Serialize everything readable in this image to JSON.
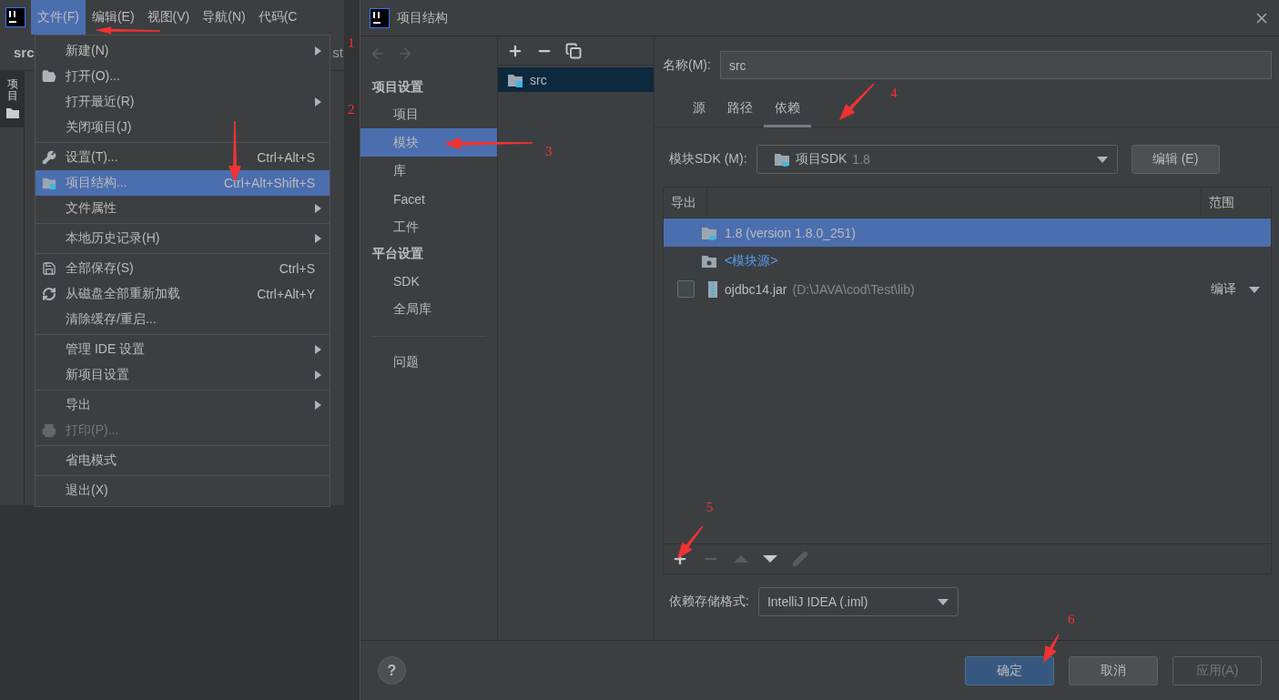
{
  "ide": {
    "menubar": [
      {
        "label": "文件(F)",
        "selected": true
      },
      {
        "label": "编辑(E)",
        "selected": false
      },
      {
        "label": "视图(V)",
        "selected": false
      },
      {
        "label": "导航(N)",
        "selected": false
      },
      {
        "label": "代码(C",
        "selected": false
      }
    ],
    "editor_tabs": [
      {
        "label": "src"
      },
      {
        "label": "st"
      }
    ],
    "tool_window": {
      "label": "项目"
    },
    "file_menu": {
      "groups": [
        [
          {
            "label": "新建(N)",
            "submenu": true,
            "selected": false,
            "disabled": false
          },
          {
            "label": "打开(O)...",
            "kind": "folder-open",
            "selected": false,
            "disabled": false
          },
          {
            "label": "打开最近(R)",
            "submenu": true,
            "selected": false,
            "disabled": false
          },
          {
            "label": "关闭项目(J)",
            "selected": false,
            "disabled": false
          }
        ],
        [
          {
            "label": "设置(T)...",
            "kind": "wrench",
            "shortcut": "Ctrl+Alt+S",
            "selected": false,
            "disabled": false
          },
          {
            "label": "项目结构...",
            "kind": "project-structure",
            "shortcut": "Ctrl+Alt+Shift+S",
            "selected": true,
            "disabled": false
          },
          {
            "label": "文件属性",
            "submenu": true,
            "selected": false,
            "disabled": false
          }
        ],
        [
          {
            "label": "本地历史记录(H)",
            "submenu": true,
            "selected": false,
            "disabled": false
          }
        ],
        [
          {
            "label": "全部保存(S)",
            "kind": "save",
            "shortcut": "Ctrl+S",
            "selected": false,
            "disabled": false
          },
          {
            "label": "从磁盘全部重新加载",
            "kind": "refresh",
            "shortcut": "Ctrl+Alt+Y",
            "selected": false,
            "disabled": false
          },
          {
            "label": "清除缓存/重启...",
            "selected": false,
            "disabled": false
          }
        ],
        [
          {
            "label": "管理 IDE 设置",
            "submenu": true,
            "selected": false,
            "disabled": false
          },
          {
            "label": "新项目设置",
            "submenu": true,
            "selected": false,
            "disabled": false
          }
        ],
        [
          {
            "label": "导出",
            "submenu": true,
            "selected": false,
            "disabled": false
          },
          {
            "label": "打印(P)...",
            "kind": "printer",
            "selected": false,
            "disabled": true
          }
        ],
        [
          {
            "label": "省电模式",
            "selected": false,
            "disabled": false
          }
        ],
        [
          {
            "label": "退出(X)",
            "selected": false,
            "disabled": false
          }
        ]
      ]
    }
  },
  "dialog": {
    "title": "项目结构",
    "nav": {
      "sections": [
        {
          "title": "项目设置",
          "items": [
            {
              "label": "项目",
              "selected": false
            },
            {
              "label": "模块",
              "selected": true
            },
            {
              "label": "库",
              "selected": false
            },
            {
              "label": "Facet",
              "selected": false
            },
            {
              "label": "工件",
              "selected": false
            }
          ]
        },
        {
          "title": "平台设置",
          "items": [
            {
              "label": "SDK",
              "selected": false
            },
            {
              "label": "全局库",
              "selected": false
            }
          ]
        }
      ],
      "extra": [
        {
          "label": "问题",
          "selected": false
        }
      ]
    },
    "modules": [
      {
        "label": "src",
        "selected": true
      }
    ],
    "name_field": {
      "label": "名称(M):",
      "value": "src"
    },
    "tabs": [
      {
        "label": "源",
        "selected": false
      },
      {
        "label": "路径",
        "selected": false
      },
      {
        "label": "依赖",
        "selected": true
      }
    ],
    "sdk": {
      "label": "模块SDK (M):",
      "value": "项目SDK",
      "version": "1.8",
      "button": "编辑 (E)"
    },
    "table": {
      "columns": [
        "导出",
        "范围"
      ],
      "rows": [
        {
          "kind": "sdk",
          "name": "1.8 (version 1.8.0_251)",
          "selected": true
        },
        {
          "kind": "source",
          "name": "<模块源>",
          "selected": false
        },
        {
          "kind": "library",
          "name": "ojdbc14.jar",
          "path": "(D:\\JAVA\\cod\\Test\\lib)",
          "scope": "编译",
          "checked": false,
          "selected": false
        }
      ],
      "toolbar": [
        {
          "kind": "add",
          "disabled": false
        },
        {
          "kind": "remove",
          "disabled": true
        },
        {
          "kind": "up",
          "disabled": true
        },
        {
          "kind": "down",
          "disabled": false
        },
        {
          "kind": "edit",
          "disabled": true
        }
      ]
    },
    "storage": {
      "label": "依赖存储格式:",
      "value": "IntelliJ IDEA (.iml)"
    },
    "footer": {
      "help": "?",
      "buttons": [
        {
          "label": "确定",
          "kind": "primary",
          "disabled": false
        },
        {
          "label": "取消",
          "kind": "normal",
          "disabled": false
        },
        {
          "label": "应用(A)",
          "kind": "normal",
          "disabled": true
        }
      ]
    }
  },
  "annotations": [
    {
      "label": "1"
    },
    {
      "label": "2"
    },
    {
      "label": "3"
    },
    {
      "label": "4"
    },
    {
      "label": "5"
    },
    {
      "label": "6"
    }
  ]
}
